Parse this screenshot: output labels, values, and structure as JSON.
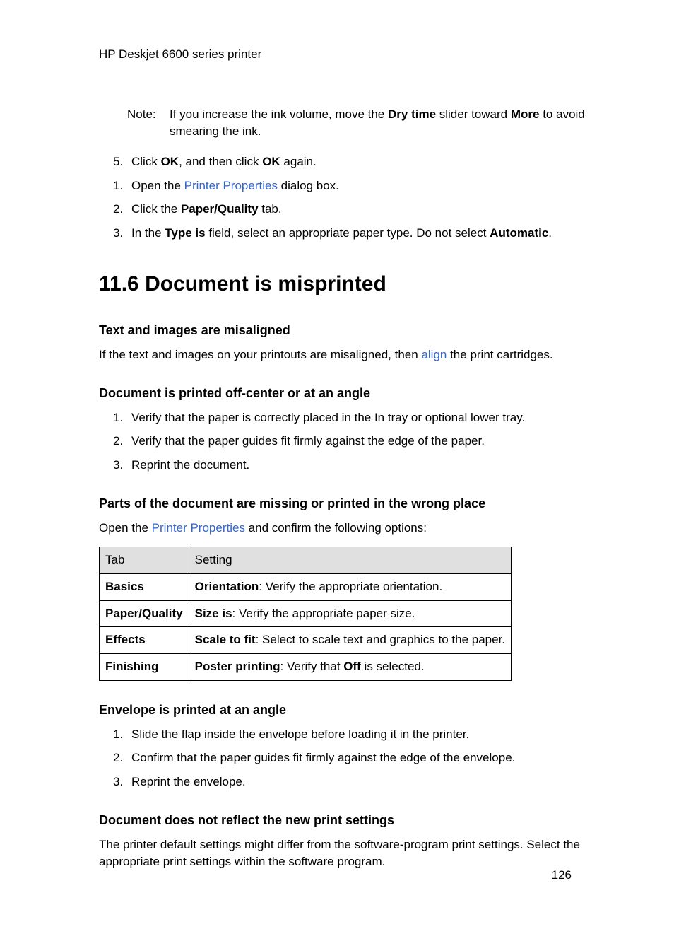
{
  "header": "HP Deskjet 6600 series printer",
  "note": {
    "label": "Note:",
    "pre": "If you increase the ink volume, move the ",
    "bold1": "Dry time",
    "mid": " slider toward ",
    "bold2": "More",
    "post": " to avoid smearing the ink."
  },
  "listA": {
    "i5": {
      "n": "5.",
      "a": "Click ",
      "b1": "OK",
      "b": ", and then click ",
      "b2": "OK",
      "c": " again."
    },
    "i1": {
      "n": "1.",
      "a": "Open the ",
      "link": "Printer Properties",
      "c": " dialog box."
    },
    "i2": {
      "n": "2.",
      "a": "Click the ",
      "b1": "Paper/Quality",
      "c": " tab."
    },
    "i3": {
      "n": "3.",
      "a": "In the ",
      "b1": "Type is",
      "b": " field, select an appropriate paper type. Do not select ",
      "b2": "Automatic",
      "c": "."
    }
  },
  "h1": "11.6  Document is misprinted",
  "sec1": {
    "h": "Text and images are misaligned",
    "p_a": "If the text and images on your printouts are misaligned, then ",
    "link": "align",
    "p_b": " the print cartridges."
  },
  "sec2": {
    "h": "Document is printed off-center or at an angle",
    "i1": {
      "n": "1.",
      "t": "Verify that the paper is correctly placed in the In tray or optional lower tray."
    },
    "i2": {
      "n": "2.",
      "t": "Verify that the paper guides fit firmly against the edge of the paper."
    },
    "i3": {
      "n": "3.",
      "t": "Reprint the document."
    }
  },
  "sec3": {
    "h": "Parts of the document are missing or printed in the wrong place",
    "p_a": "Open the ",
    "link": "Printer Properties",
    "p_b": " and confirm the following options:"
  },
  "table": {
    "h1": "Tab",
    "h2": "Setting",
    "r1a": "Basics",
    "r1b_bold": "Orientation",
    "r1b_rest": ": Verify the appropriate orientation.",
    "r2a": "Paper/Quality",
    "r2b_bold": "Size is",
    "r2b_rest": ": Verify the appropriate paper size.",
    "r3a": "Effects",
    "r3b_bold": "Scale to fit",
    "r3b_rest": ": Select to scale text and graphics to the paper.",
    "r4a": "Finishing",
    "r4b_bold": "Poster printing",
    "r4b_mid": ": Verify that ",
    "r4b_bold2": "Off",
    "r4b_rest": " is selected."
  },
  "sec4": {
    "h": "Envelope is printed at an angle",
    "i1": {
      "n": "1.",
      "t": "Slide the flap inside the envelope before loading it in the printer."
    },
    "i2": {
      "n": "2.",
      "t": "Confirm that the paper guides fit firmly against the edge of the envelope."
    },
    "i3": {
      "n": "3.",
      "t": "Reprint the envelope."
    }
  },
  "sec5": {
    "h": "Document does not reflect the new print settings",
    "p": "The printer default settings might differ from the software-program print settings. Select the appropriate print settings within the software program."
  },
  "pagenum": "126"
}
